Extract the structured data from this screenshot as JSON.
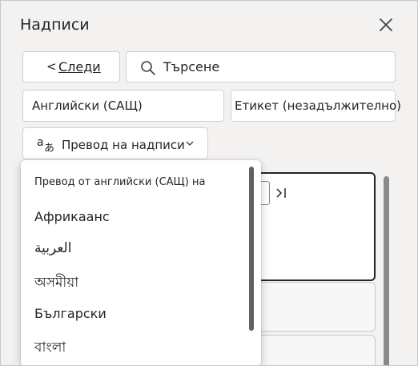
{
  "panel": {
    "title": "Надписи",
    "close_icon": "close-icon"
  },
  "toolbar": {
    "back_chevron": "<",
    "back_label": "Следи",
    "search_icon": "search-icon",
    "search_value": "Търсене"
  },
  "fields": {
    "language": "Английски (САЩ)",
    "label": "Етикет (незадължително)"
  },
  "translate": {
    "icon": "translate-icon",
    "label": "Превод на надписи",
    "chevron_icon": "chevron-down-icon"
  },
  "dropdown": {
    "header": "Превод от английски (САЩ) на",
    "items": [
      "Африкаанс",
      "العربية",
      "অসমীয়া",
      "Български",
      "বাংলা"
    ]
  },
  "colors": {
    "panel_bg": "#f3f2f1",
    "text": "#242424",
    "border": "#d1d1d1"
  }
}
